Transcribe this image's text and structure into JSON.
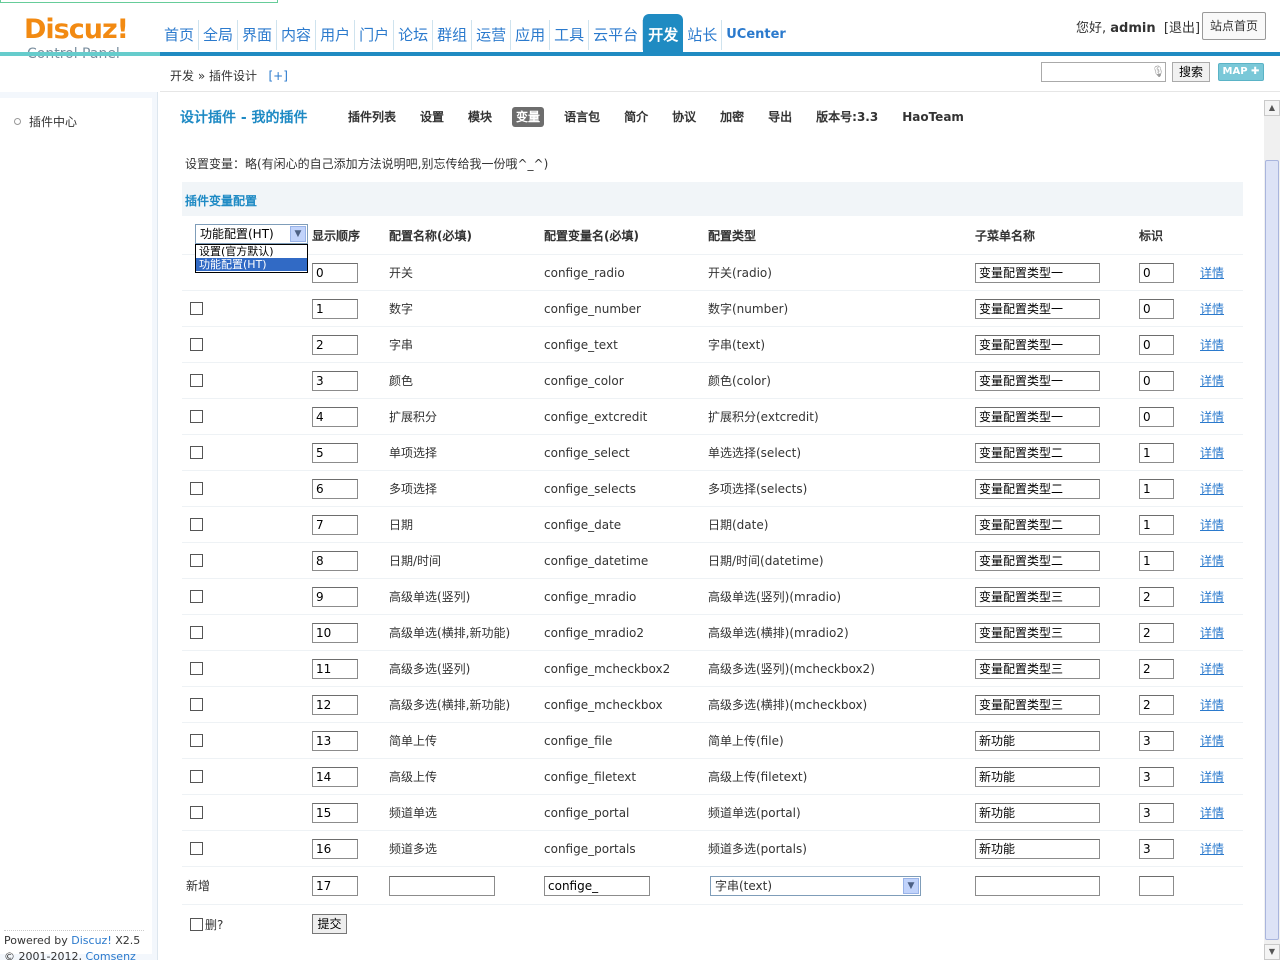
{
  "header": {
    "logo_main": "Discuz!",
    "logo_sub": "Control Panel",
    "nav": [
      "首页",
      "全局",
      "界面",
      "内容",
      "用户",
      "门户",
      "论坛",
      "群组",
      "运营",
      "应用",
      "工具",
      "云平台",
      "开发",
      "站长",
      "UCenter"
    ],
    "active_nav": "开发",
    "greeting": "您好,",
    "username": "admin",
    "logout": "[退出]",
    "site_home": "站点首页"
  },
  "subbar": {
    "crumb_1": "开发",
    "crumb_sep": "»",
    "crumb_2": "插件设计",
    "crumb_add": "[+]",
    "search_value": "",
    "search_label": "搜索",
    "map_label": "MAP ✚"
  },
  "sidebar": {
    "items": [
      {
        "label": "插件中心"
      }
    ],
    "powered_prefix": "Powered by",
    "powered_link": "Discuz!",
    "powered_version": "X2.5",
    "copyright_prefix": "© 2001-2012,",
    "copyright_link": "Comsenz Inc."
  },
  "main": {
    "title": "设计插件 - 我的插件",
    "tabs": [
      "插件列表",
      "设置",
      "模块",
      "变量",
      "语言包",
      "简介",
      "协议",
      "加密",
      "导出",
      "版本号:3.3",
      "HaoTeam"
    ],
    "active_tab": "变量",
    "note": "设置变量：略(有闲心的自己添加方法说明吧,别忘传给我一份哦^_^)",
    "section_title": "插件变量配置",
    "filter_select": {
      "value": "功能配置(HT)",
      "options": [
        "设置(官方默认)",
        "功能配置(HT)"
      ]
    },
    "columns": {
      "order": "显示顺序",
      "name": "配置名称(必填)",
      "var": "配置变量名(必填)",
      "type": "配置类型",
      "submenu": "子菜单名称",
      "flag": "标识"
    },
    "detail_label": "详情",
    "rows": [
      {
        "order": "0",
        "name": "开关",
        "var": "confige_radio",
        "type": "开关(radio)",
        "submenu": "变量配置类型一",
        "flag": "0"
      },
      {
        "order": "1",
        "name": "数字",
        "var": "confige_number",
        "type": "数字(number)",
        "submenu": "变量配置类型一",
        "flag": "0"
      },
      {
        "order": "2",
        "name": "字串",
        "var": "confige_text",
        "type": "字串(text)",
        "submenu": "变量配置类型一",
        "flag": "0"
      },
      {
        "order": "3",
        "name": "颜色",
        "var": "confige_color",
        "type": "颜色(color)",
        "submenu": "变量配置类型一",
        "flag": "0"
      },
      {
        "order": "4",
        "name": "扩展积分",
        "var": "confige_extcredit",
        "type": "扩展积分(extcredit)",
        "submenu": "变量配置类型一",
        "flag": "0"
      },
      {
        "order": "5",
        "name": "单项选择",
        "var": "confige_select",
        "type": "单选选择(select)",
        "submenu": "变量配置类型二",
        "flag": "1"
      },
      {
        "order": "6",
        "name": "多项选择",
        "var": "confige_selects",
        "type": "多项选择(selects)",
        "submenu": "变量配置类型二",
        "flag": "1"
      },
      {
        "order": "7",
        "name": "日期",
        "var": "confige_date",
        "type": "日期(date)",
        "submenu": "变量配置类型二",
        "flag": "1"
      },
      {
        "order": "8",
        "name": "日期/时间",
        "var": "confige_datetime",
        "type": "日期/时间(datetime)",
        "submenu": "变量配置类型二",
        "flag": "1"
      },
      {
        "order": "9",
        "name": "高级单选(竖列)",
        "var": "confige_mradio",
        "type": "高级单选(竖列)(mradio)",
        "submenu": "变量配置类型三",
        "flag": "2"
      },
      {
        "order": "10",
        "name": "高级单选(横排,新功能)",
        "var": "confige_mradio2",
        "type": "高级单选(横排)(mradio2)",
        "submenu": "变量配置类型三",
        "flag": "2"
      },
      {
        "order": "11",
        "name": "高级多选(竖列)",
        "var": "confige_mcheckbox2",
        "type": "高级多选(竖列)(mcheckbox2)",
        "submenu": "变量配置类型三",
        "flag": "2"
      },
      {
        "order": "12",
        "name": "高级多选(横排,新功能)",
        "var": "confige_mcheckbox",
        "type": "高级多选(横排)(mcheckbox)",
        "submenu": "变量配置类型三",
        "flag": "2"
      },
      {
        "order": "13",
        "name": "简单上传",
        "var": "confige_file",
        "type": "简单上传(file)",
        "submenu": "新功能",
        "flag": "3"
      },
      {
        "order": "14",
        "name": "高级上传",
        "var": "confige_filetext",
        "type": "高级上传(filetext)",
        "submenu": "新功能",
        "flag": "3"
      },
      {
        "order": "15",
        "name": "频道单选",
        "var": "confige_portal",
        "type": "频道单选(portal)",
        "submenu": "新功能",
        "flag": "3"
      },
      {
        "order": "16",
        "name": "频道多选",
        "var": "confige_portals",
        "type": "频道多选(portals)",
        "submenu": "新功能",
        "flag": "3"
      }
    ],
    "new_row": {
      "label": "新增",
      "order": "17",
      "name": "",
      "var": "confige_",
      "type": "字串(text)",
      "submenu": "",
      "flag": ""
    },
    "delete_label": "删?",
    "submit_label": "提交"
  }
}
